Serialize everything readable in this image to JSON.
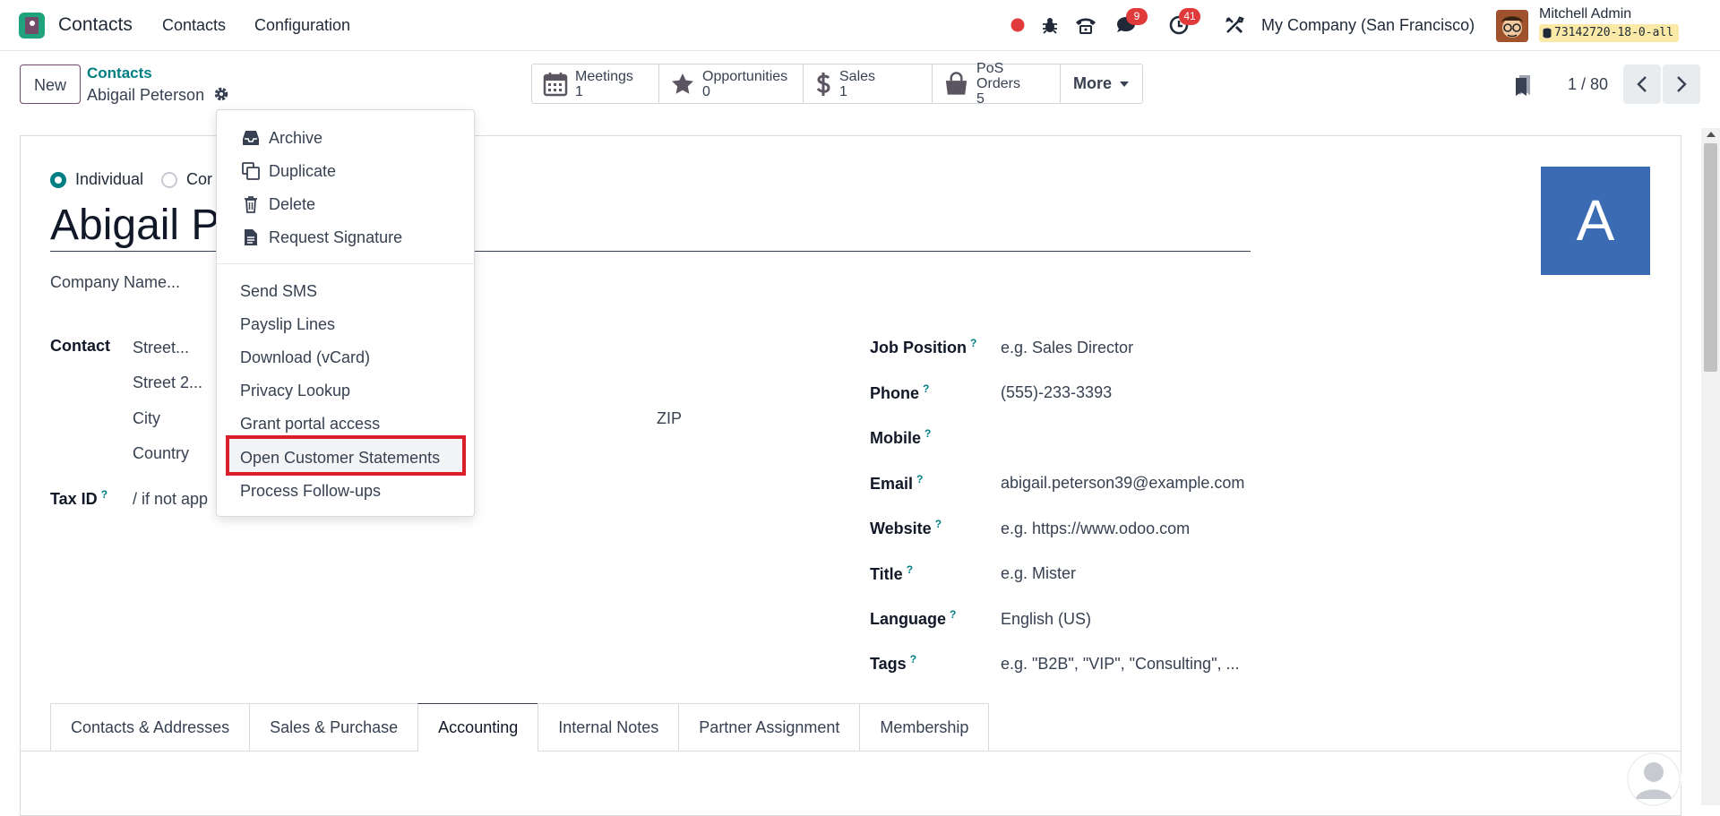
{
  "navbar": {
    "app_name": "Contacts",
    "menu": [
      "Contacts",
      "Configuration"
    ],
    "discuss_badge": "9",
    "activity_badge": "41",
    "company": "My Company (San Francisco)",
    "user_name": "Mitchell Admin",
    "db_name": "73142720-18-0-all"
  },
  "control": {
    "new_label": "New",
    "breadcrumb_parent": "Contacts",
    "breadcrumb_current": "Abigail Peterson",
    "smart_buttons": [
      {
        "label": "Meetings",
        "value": "1",
        "icon": "calendar-icon"
      },
      {
        "label": "Opportunities",
        "value": "0",
        "icon": "star-icon"
      },
      {
        "label": "Sales",
        "value": "1",
        "icon": "dollar-icon"
      },
      {
        "label": "PoS Orders",
        "value": "5",
        "icon": "shopping-bag-icon"
      }
    ],
    "more_label": "More",
    "pager": "1 / 80"
  },
  "form": {
    "type_individual": "Individual",
    "type_company_partial": "Cor",
    "name_partial": "Abigail Pe",
    "company_name_placeholder": "Company Name...",
    "contact_label": "Contact",
    "street_placeholder": "Street...",
    "street2_placeholder": "Street 2...",
    "city_placeholder": "City",
    "zip_placeholder": "ZIP",
    "country_placeholder": "Country",
    "tax_id_label": "Tax ID",
    "tax_id_placeholder": "/ if not app",
    "avatar_letter": "A",
    "right_fields": [
      {
        "label": "Job Position",
        "value": "",
        "placeholder": "e.g. Sales Director"
      },
      {
        "label": "Phone",
        "value": "(555)-233-3393",
        "placeholder": ""
      },
      {
        "label": "Mobile",
        "value": "",
        "placeholder": ""
      },
      {
        "label": "Email",
        "value": "abigail.peterson39@example.com",
        "placeholder": ""
      },
      {
        "label": "Website",
        "value": "",
        "placeholder": "e.g. https://www.odoo.com"
      },
      {
        "label": "Title",
        "value": "",
        "placeholder": "e.g. Mister"
      },
      {
        "label": "Language",
        "value": "English (US)",
        "placeholder": ""
      },
      {
        "label": "Tags",
        "value": "",
        "placeholder": "e.g. \"B2B\", \"VIP\", \"Consulting\", ..."
      }
    ],
    "help_mark": "?"
  },
  "tabs": [
    "Contacts & Addresses",
    "Sales & Purchase",
    "Accounting",
    "Internal Notes",
    "Partner Assignment",
    "Membership"
  ],
  "active_tab": "Accounting",
  "dropdown": {
    "top_items": [
      {
        "label": "Archive",
        "icon": "inbox-icon"
      },
      {
        "label": "Duplicate",
        "icon": "copy-icon"
      },
      {
        "label": "Delete",
        "icon": "trash-icon"
      },
      {
        "label": "Request Signature",
        "icon": "file-icon"
      }
    ],
    "bottom_items": [
      "Send SMS",
      "Payslip Lines",
      "Download (vCard)",
      "Privacy Lookup",
      "Grant portal access",
      "Open Customer Statements",
      "Process Follow-ups"
    ],
    "highlighted": "Open Customer Statements"
  },
  "colors": {
    "brand": "#714b67",
    "accent": "#017e84",
    "badge": "#e03a3a",
    "avatar_bg": "#3a6bb3",
    "highlight_box": "#d9202a"
  }
}
